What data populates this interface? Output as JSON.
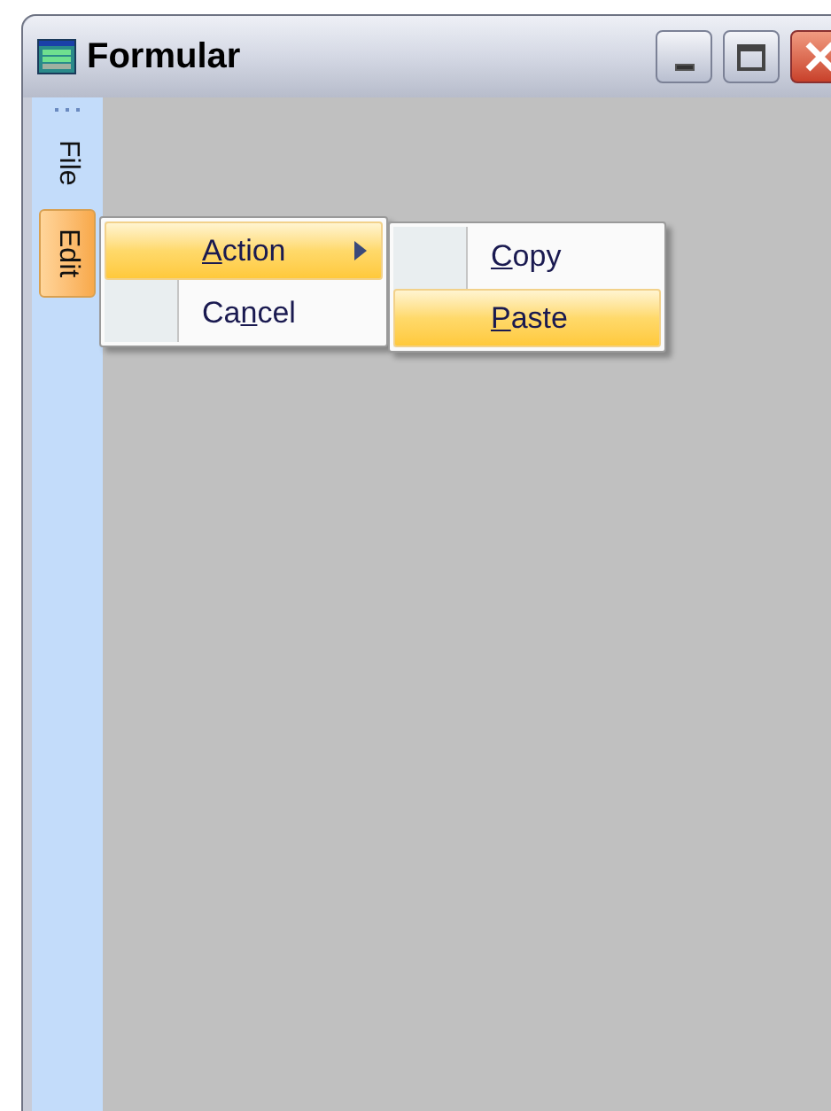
{
  "window": {
    "title": "Formular"
  },
  "menubar": {
    "items": [
      {
        "label": "File",
        "selected": false
      },
      {
        "label": "Edit",
        "selected": true
      }
    ]
  },
  "menus": [
    {
      "items": [
        {
          "label_parts": [
            {
              "text": "A",
              "underline": true
            },
            {
              "text": "ction",
              "underline": false
            }
          ],
          "selected": true,
          "has_submenu": true
        },
        {
          "label_parts": [
            {
              "text": "Ca",
              "underline": false
            },
            {
              "text": "n",
              "underline": true
            },
            {
              "text": "cel",
              "underline": false
            }
          ],
          "selected": false,
          "has_submenu": false
        }
      ]
    },
    {
      "items": [
        {
          "label_parts": [
            {
              "text": "C",
              "underline": true
            },
            {
              "text": "opy",
              "underline": false
            }
          ],
          "selected": false,
          "has_submenu": false
        },
        {
          "label_parts": [
            {
              "text": "P",
              "underline": true
            },
            {
              "text": "aste",
              "underline": false
            }
          ],
          "selected": true,
          "has_submenu": false
        }
      ]
    }
  ]
}
